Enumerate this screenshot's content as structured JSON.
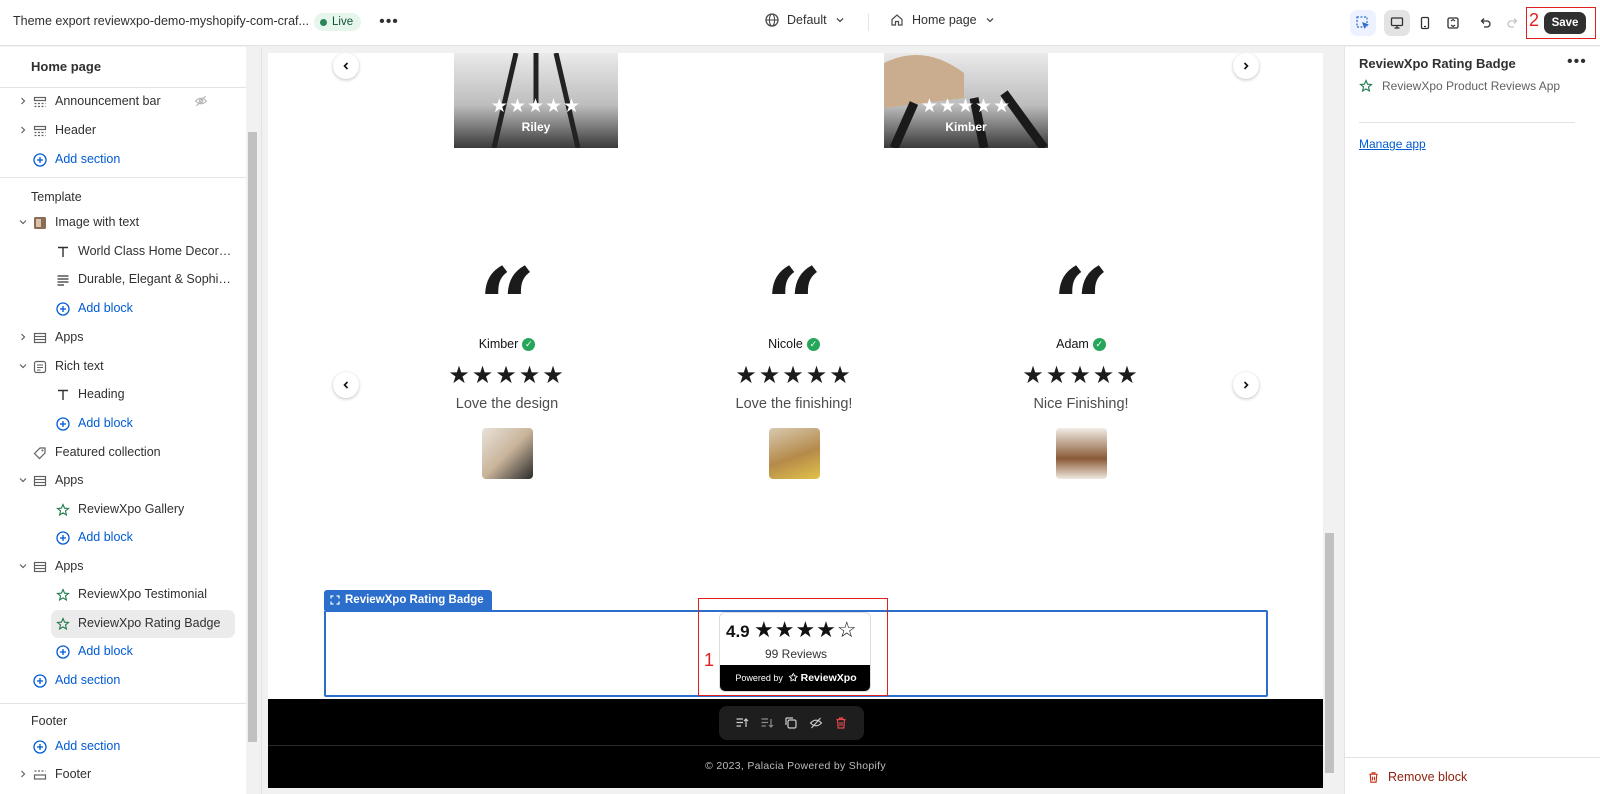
{
  "topbar": {
    "theme_name": "Theme export reviewxpo-demo-myshopify-com-craf...",
    "status": "Live",
    "more": "•••",
    "theme_selector": "Default",
    "page_selector": "Home page",
    "save_label": "Save"
  },
  "annotations": {
    "badge": "1",
    "save": "2"
  },
  "sidebar": {
    "title": "Home page",
    "header_group": [
      {
        "label": "Announcement bar"
      },
      {
        "label": "Header"
      }
    ],
    "add_section": "Add section",
    "template_label": "Template",
    "items": [
      {
        "label": "Image with text"
      },
      {
        "label": "World Class Home Decor & ..."
      },
      {
        "label": "Durable, Elegant & Sophisti..."
      },
      {
        "label": "Add block"
      },
      {
        "label": "Apps"
      },
      {
        "label": "Rich text"
      },
      {
        "label": "Heading"
      },
      {
        "label": "Add block"
      },
      {
        "label": "Featured collection"
      },
      {
        "label": "Apps"
      },
      {
        "label": "ReviewXpo Gallery"
      },
      {
        "label": "Add block"
      },
      {
        "label": "Apps"
      },
      {
        "label": "ReviewXpo Testimonial"
      },
      {
        "label": "ReviewXpo Rating Badge"
      },
      {
        "label": "Add block"
      },
      {
        "label": "Add section"
      }
    ],
    "footer_label": "Footer",
    "footer_add_section": "Add section",
    "footer_item": "Footer"
  },
  "preview": {
    "top_cards": [
      {
        "name": "Riley",
        "stars": "★★★★★"
      },
      {
        "name": "Kimber",
        "stars": "★★★★★"
      }
    ],
    "testimonials": [
      {
        "quote": "“",
        "name": "Kimber",
        "stars": "★★★★★",
        "text": "Love the design"
      },
      {
        "quote": "“",
        "name": "Nicole",
        "stars": "★★★★★",
        "text": "Love the finishing!"
      },
      {
        "quote": "“",
        "name": "Adam",
        "stars": "★★★★★",
        "text": "Nice Finishing!"
      }
    ],
    "selected_label": "ReviewXpo Rating Badge",
    "badge": {
      "rating": "4.9",
      "stars": "★★★★☆",
      "count": "99 Reviews",
      "powered_by": "Powered by",
      "brand": "ReviewXpo"
    },
    "footer_text": "© 2023, Palacia Powered by Shopify"
  },
  "right_panel": {
    "title": "ReviewXpo Rating Badge",
    "more": "•••",
    "app_name": "ReviewXpo Product Reviews App",
    "manage_link": "Manage app",
    "remove_label": "Remove block"
  },
  "colors": {
    "accent": "#005bd3",
    "selection": "#2c6ecb",
    "annotation": "#e02020",
    "save_bg": "#303030"
  }
}
